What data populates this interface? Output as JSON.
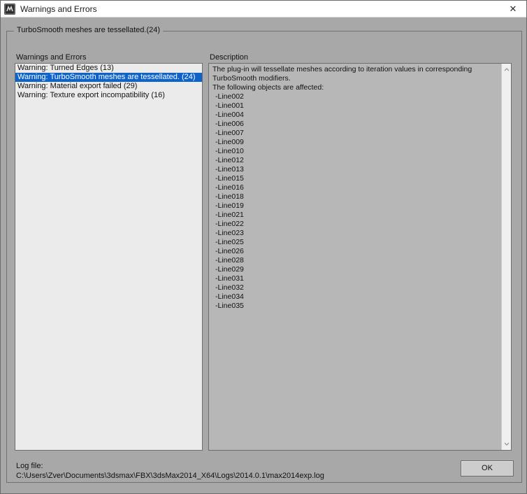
{
  "titlebar": {
    "title": "Warnings and Errors",
    "close_glyph": "✕"
  },
  "group": {
    "label": "TurboSmooth meshes are tessellated.(24)"
  },
  "warnings_panel": {
    "label": "Warnings and Errors",
    "items": [
      {
        "label": "Warning: Turned Edges (13)",
        "selected": false
      },
      {
        "label": "Warning: TurboSmooth meshes are tessellated. (24)",
        "selected": true
      },
      {
        "label": "Warning: Material export failed (29)",
        "selected": false
      },
      {
        "label": "Warning: Texture export incompatibility (16)",
        "selected": false
      }
    ]
  },
  "description_panel": {
    "label": "Description",
    "intro_lines": [
      "The plug-in will tessellate meshes according to iteration values in corresponding",
      "TurboSmooth modifiers.",
      "The following objects are affected:"
    ],
    "objects": [
      "-Line002",
      "-Line001",
      "-Line004",
      "-Line006",
      "-Line007",
      "-Line009",
      "-Line010",
      "-Line012",
      "-Line013",
      "-Line015",
      "-Line016",
      "-Line018",
      "-Line019",
      "-Line021",
      "-Line022",
      "-Line023",
      "-Line025",
      "-Line026",
      "-Line028",
      "-Line029",
      "-Line031",
      "-Line032",
      "-Line034",
      "-Line035"
    ]
  },
  "footer": {
    "log_label": "Log file:",
    "log_path": "C:\\Users\\Zver\\Documents\\3dsmax\\FBX\\3dsMax2014_X64\\Logs\\2014.0.1\\max2014exp.log",
    "ok_label": "OK"
  },
  "colors": {
    "titlebar_bg": "#ffffff",
    "dialog_bg": "#a8a8a8",
    "listbox_bg": "#ebebeb",
    "descbox_bg": "#b7b7b7",
    "selection_bg": "#0e63cb",
    "selection_text": "#ffffff",
    "scrollbar_track": "#f0f0f0"
  }
}
